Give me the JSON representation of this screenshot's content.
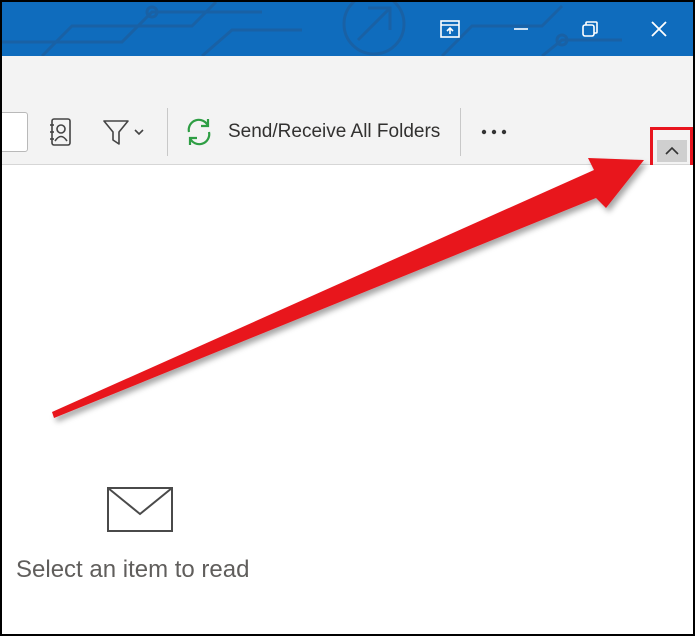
{
  "titlebar": {
    "color": "#0f6cbd",
    "buttons": [
      {
        "name": "display-options",
        "icon": "ribbon-display-options-icon"
      },
      {
        "name": "minimize",
        "icon": "minimize-icon"
      },
      {
        "name": "restore",
        "icon": "restore-icon"
      },
      {
        "name": "close",
        "icon": "close-icon"
      }
    ]
  },
  "ribbon": {
    "address_book_icon": "address-book-icon",
    "filter_icon": "filter-icon",
    "send_receive_label": "Send/Receive All Folders",
    "send_receive_icon": "sync-icon",
    "more_icon": "more-horizontal-icon",
    "collapse_icon": "chevron-up-icon"
  },
  "reading_pane": {
    "empty_icon": "envelope-icon",
    "empty_message": "Select an item to read"
  },
  "annotation": {
    "arrow_color": "#e8141e",
    "highlight_color": "#e8141e"
  }
}
